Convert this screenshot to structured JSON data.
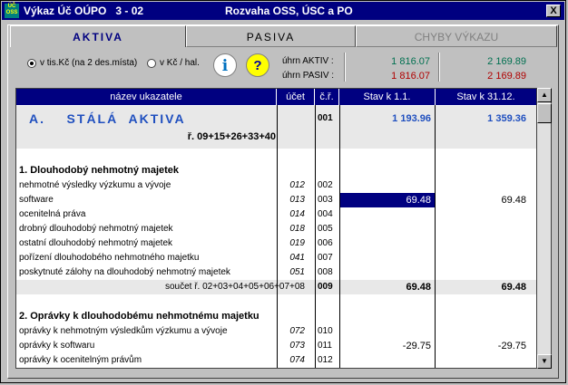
{
  "window": {
    "icon_text": "ÚČ OSS",
    "title_left": "Výkaz Úč OÚPO   3 - 02",
    "title_right": "Rozvaha OSS, ÚSC a PO",
    "close": "X"
  },
  "tabs": [
    {
      "label": "AKTIVA",
      "state": "active"
    },
    {
      "label": "PASIVA",
      "state": "inactive"
    },
    {
      "label": "CHYBY VÝKAZU",
      "state": "disabled"
    }
  ],
  "units": {
    "option1": "v tis.Kč (na 2 des.místa)",
    "option2": "v Kč / hal.",
    "selected": "option1"
  },
  "buttons": {
    "info": "i",
    "help": "?"
  },
  "summary": {
    "aktiv_label": "úhrn AKTIV :",
    "pasiv_label": "úhrn PASIV :",
    "aktiv_1": "1 816.07",
    "aktiv_2": "2 169.89",
    "pasiv_1": "1 816.07",
    "pasiv_2": "2 169.89"
  },
  "table": {
    "headers": {
      "name": "název ukazatele",
      "ucet": "účet",
      "cr": "č.ř.",
      "s1": "Stav k 1.1.",
      "s2": "Stav k 31.12."
    },
    "section_a": {
      "label": "A.    STÁLÁ  AKTIVA",
      "formula": "ř.  09+15+26+33+40",
      "cr": "001",
      "s1": "1 193.96",
      "s2": "1 359.36"
    },
    "group1_title": "1. Dlouhodobý nehmotný majetek",
    "group1_rows": [
      {
        "name": "nehmotné výsledky výzkumu a vývoje",
        "ucet": "012",
        "cr": "002",
        "s1": "",
        "s2": ""
      },
      {
        "name": "software",
        "ucet": "013",
        "cr": "003",
        "s1": "69.48",
        "s2": "69.48"
      },
      {
        "name": "ocenitelná práva",
        "ucet": "014",
        "cr": "004",
        "s1": "",
        "s2": ""
      },
      {
        "name": "drobný dlouhodobý nehmotný majetek",
        "ucet": "018",
        "cr": "005",
        "s1": "",
        "s2": ""
      },
      {
        "name": "ostatní dlouhodobý nehmotný majetek",
        "ucet": "019",
        "cr": "006",
        "s1": "",
        "s2": ""
      },
      {
        "name": "pořízení dlouhodobého nehmotného majetku",
        "ucet": "041",
        "cr": "007",
        "s1": "",
        "s2": ""
      },
      {
        "name": "poskytnuté zálohy na dlouhodobý nehmotný majetek",
        "ucet": "051",
        "cr": "008",
        "s1": "",
        "s2": ""
      }
    ],
    "group1_sum": {
      "label": "součet ř. 02+03+04+05+06+07+08",
      "cr": "009",
      "s1": "69.48",
      "s2": "69.48"
    },
    "group2_title": "2. Oprávky k dlouhodobému nehmotnému majetku",
    "group2_rows": [
      {
        "name": "oprávky k nehmotným výsledkům výzkumu a vývoje",
        "ucet": "072",
        "cr": "010",
        "s1": "",
        "s2": ""
      },
      {
        "name": "oprávky k softwaru",
        "ucet": "073",
        "cr": "011",
        "s1": "-29.75",
        "s2": "-29.75"
      },
      {
        "name": "oprávky k ocenitelným právům",
        "ucet": "074",
        "cr": "012",
        "s1": "",
        "s2": ""
      }
    ]
  },
  "colors": {
    "header_bg": "#000080",
    "aktiva_blue": "#1f4fbf",
    "green": "#007050",
    "red": "#b00000",
    "selection": "#000080"
  },
  "icons": {
    "scroll_up": "triangle-up",
    "scroll_down": "triangle-down"
  }
}
